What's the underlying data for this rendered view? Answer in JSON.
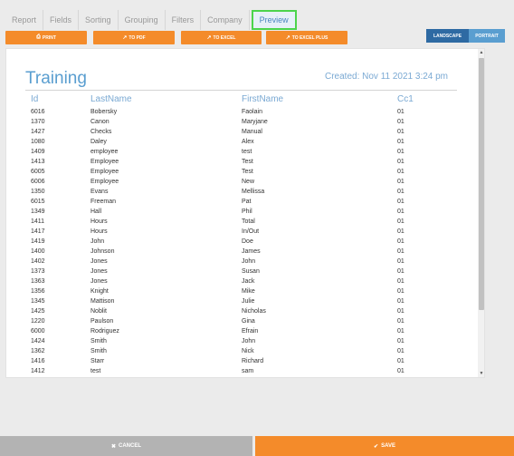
{
  "tabs": [
    {
      "label": "Report",
      "active": false
    },
    {
      "label": "Fields",
      "active": false
    },
    {
      "label": "Sorting",
      "active": false
    },
    {
      "label": "Grouping",
      "active": false
    },
    {
      "label": "Filters",
      "active": false
    },
    {
      "label": "Company",
      "active": false
    },
    {
      "label": "Preview",
      "active": true
    }
  ],
  "toolbar": {
    "print": {
      "label": "PRINT",
      "icon": "print-icon"
    },
    "pdf": {
      "label": "TO PDF",
      "icon": "external-link-icon"
    },
    "excel": {
      "label": "TO EXCEL",
      "icon": "external-link-icon"
    },
    "excel_plus": {
      "label": "TO EXCEL PLUS",
      "icon": "external-link-icon"
    }
  },
  "orientation": {
    "landscape": "LANDSCAPE",
    "portrait": "PORTRAIT",
    "selected": "landscape"
  },
  "report": {
    "title": "Training",
    "created": "Created: Nov 11 2021 3:24 pm",
    "columns": [
      "Id",
      "LastName",
      "FirstName",
      "Cc1"
    ],
    "rows": [
      [
        "6016",
        "Bobersky",
        "Faolain",
        "01"
      ],
      [
        "1370",
        "Canon",
        "Maryjane",
        "01"
      ],
      [
        "1427",
        "Checks",
        "Manual",
        "01"
      ],
      [
        "1080",
        "Daley",
        "Alex",
        "01"
      ],
      [
        "1409",
        "employee",
        "test",
        "01"
      ],
      [
        "1413",
        "Employee",
        "Test",
        "01"
      ],
      [
        "6005",
        "Employee",
        "Test",
        "01"
      ],
      [
        "6006",
        "Employee",
        "New",
        "01"
      ],
      [
        "1350",
        "Evans",
        "Mellissa",
        "01"
      ],
      [
        "6015",
        "Freeman",
        "Pat",
        "01"
      ],
      [
        "1349",
        "Hall",
        "Phil",
        "01"
      ],
      [
        "1411",
        "Hours",
        "Total",
        "01"
      ],
      [
        "1417",
        "Hours",
        "In/Out",
        "01"
      ],
      [
        "1419",
        "John",
        "Doe",
        "01"
      ],
      [
        "1400",
        "Johnson",
        "James",
        "01"
      ],
      [
        "1402",
        "Jones",
        "John",
        "01"
      ],
      [
        "1373",
        "Jones",
        "Susan",
        "01"
      ],
      [
        "1363",
        "Jones",
        "Jack",
        "01"
      ],
      [
        "1356",
        "Knight",
        "Mike",
        "01"
      ],
      [
        "1345",
        "Mattison",
        "Julie",
        "01"
      ],
      [
        "1425",
        "Noblit",
        "Nicholas",
        "01"
      ],
      [
        "1220",
        "Paulson",
        "Gina",
        "01"
      ],
      [
        "6000",
        "Rodriguez",
        "Efrain",
        "01"
      ],
      [
        "1424",
        "Smith",
        "John",
        "01"
      ],
      [
        "1362",
        "Smith",
        "Nick",
        "01"
      ],
      [
        "1416",
        "Starr",
        "Richard",
        "01"
      ],
      [
        "1412",
        "test",
        "sam",
        "01"
      ]
    ]
  },
  "footer": {
    "cancel": {
      "label": "CANCEL",
      "icon": "close-icon"
    },
    "save": {
      "label": "SAVE",
      "icon": "check-icon"
    }
  },
  "colors": {
    "accent_orange": "#f48b2a",
    "accent_blue": "#5a9ed0",
    "preview_highlight": "#4cd44c"
  }
}
